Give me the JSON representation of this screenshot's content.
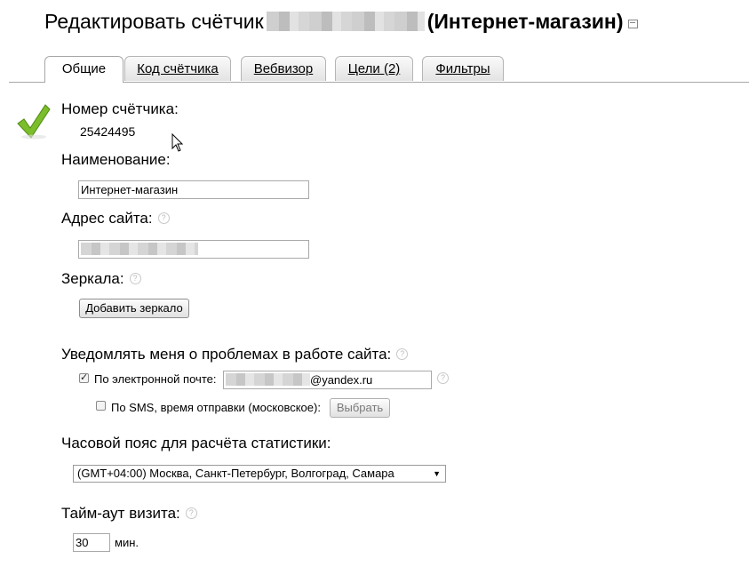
{
  "header": {
    "title_prefix": "Редактировать счётчик",
    "title_suffix": "(Интернет-магазин)"
  },
  "tabs": [
    {
      "label": "Общие",
      "active": true
    },
    {
      "label": "Код счётчика"
    },
    {
      "label": "Вебвизор"
    },
    {
      "label": "Цели (2)"
    },
    {
      "label": "Фильтры"
    }
  ],
  "form": {
    "counter_number_label": "Номер счётчика:",
    "counter_number_value": "25424495",
    "name_label": "Наименование:",
    "name_value": "Интернет-магазин",
    "site_label": "Адрес сайта:",
    "mirrors_label": "Зеркала:",
    "add_mirror_button": "Добавить зеркало",
    "notify_label": "Уведомлять меня о проблемах в работе сайта:",
    "email_label": "По электронной почте:",
    "email_checked": true,
    "email_domain": "@yandex.ru",
    "sms_label": "По SMS, время отправки (московское):",
    "sms_checked": false,
    "choose_button": "Выбрать",
    "timezone_label": "Часовой пояс для расчёта статистики:",
    "timezone_value": "(GMT+04:00) Москва, Санкт-Петербург, Волгоград, Самара",
    "timeout_label": "Тайм-аут визита:",
    "timeout_value": "30",
    "timeout_unit": "мин."
  },
  "icons": {
    "success": "checkmark-icon",
    "help": "question-icon",
    "external": "external-window-icon",
    "dropdown": "dropdown-arrow-icon"
  },
  "colors": {
    "check_green": "#7bbd2a",
    "tab_border": "#b5b5b5"
  }
}
